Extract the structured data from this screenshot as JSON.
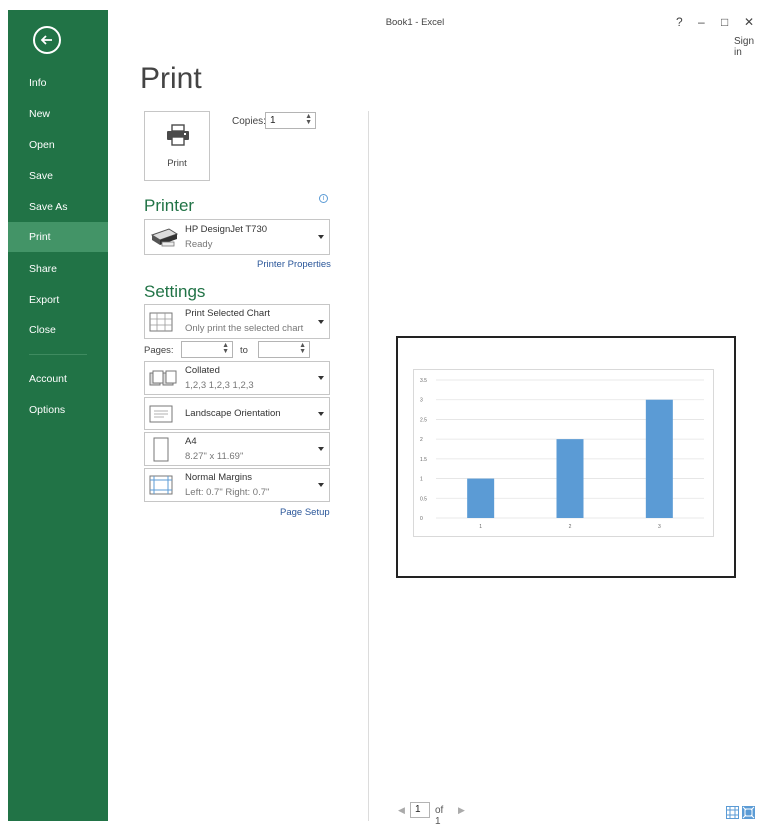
{
  "window": {
    "title": "Book1 - Excel",
    "help": "?",
    "minimize": "–",
    "maximize": "□",
    "close": "✕",
    "sign_in": "Sign in"
  },
  "sidebar": {
    "items": [
      {
        "label": "Info"
      },
      {
        "label": "New"
      },
      {
        "label": "Open"
      },
      {
        "label": "Save"
      },
      {
        "label": "Save As"
      },
      {
        "label": "Print"
      },
      {
        "label": "Share"
      },
      {
        "label": "Export"
      },
      {
        "label": "Close"
      },
      {
        "label": "Account"
      },
      {
        "label": "Options"
      }
    ],
    "active_item": "Print"
  },
  "page": {
    "title": "Print"
  },
  "print_button": {
    "label": "Print"
  },
  "copies": {
    "label": "Copies:",
    "value": "1"
  },
  "printer": {
    "heading": "Printer",
    "name": "HP DesignJet T730",
    "status": "Ready",
    "properties_link": "Printer Properties"
  },
  "settings": {
    "heading": "Settings",
    "what_to_print": {
      "title": "Print Selected Chart",
      "subtitle": "Only print the selected chart"
    },
    "pages": {
      "label": "Pages:",
      "from": "",
      "to_label": "to",
      "to": ""
    },
    "collation": {
      "title": "Collated",
      "subtitle": "1,2,3   1,2,3   1,2,3"
    },
    "orientation": {
      "title": "Landscape Orientation"
    },
    "paper": {
      "title": "A4",
      "subtitle": "8.27\" x 11.69\""
    },
    "margins": {
      "title": "Normal Margins",
      "subtitle": "Left: 0.7\"   Right: 0.7\""
    },
    "page_setup_link": "Page Setup"
  },
  "preview": {
    "page_current": "1",
    "page_total_label": "of 1",
    "prev": "◀",
    "next": "▶"
  },
  "colors": {
    "brand_green": "#217346",
    "bar": "#5b9bd5",
    "link": "#2b579a"
  },
  "chart_data": {
    "type": "bar",
    "categories": [
      "1",
      "2",
      "3"
    ],
    "values": [
      1,
      2,
      3
    ],
    "ylim": [
      0,
      3.5
    ],
    "yticks": [
      "0",
      "0.5",
      "1",
      "1.5",
      "2",
      "2.5",
      "3",
      "3.5"
    ],
    "grid": true,
    "legend": "none"
  }
}
